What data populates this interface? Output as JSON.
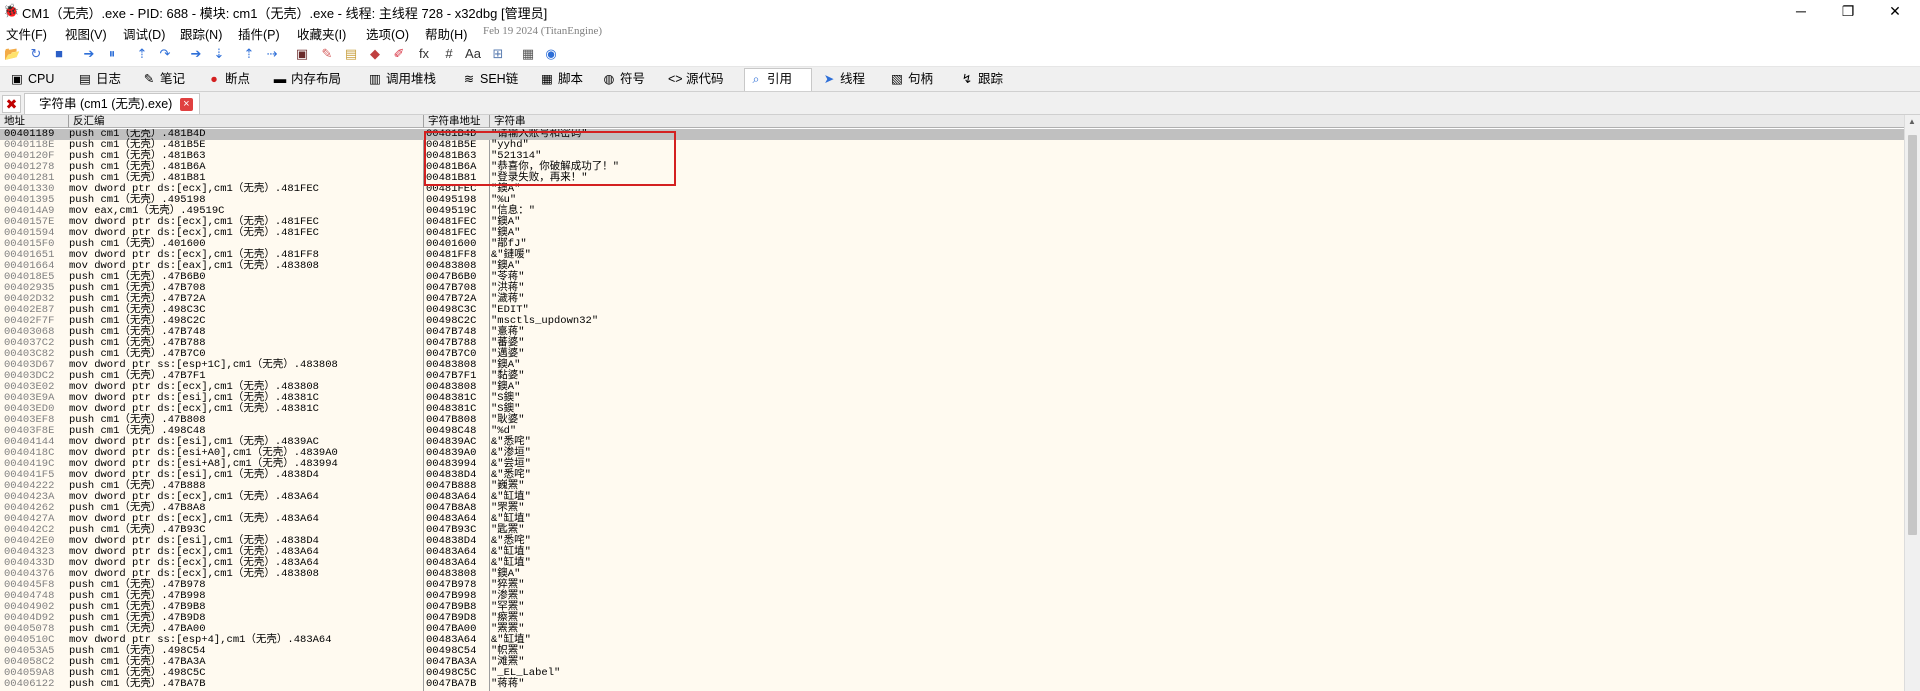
{
  "window": {
    "title": "CM1（无壳）.exe - PID: 688 - 模块: cm1（无壳）.exe - 线程: 主线程 728 - x32dbg [管理员]",
    "minimize": "─",
    "restore": "❐",
    "close": "✕"
  },
  "menu": {
    "items": [
      "文件(F)",
      "视图(V)",
      "调试(D)",
      "跟踪(N)",
      "插件(P)",
      "收藏夹(I)",
      "选项(O)",
      "帮助(H)"
    ],
    "date": "Feb 19 2024 (TitanEngine)"
  },
  "toolbar": {
    "icons": [
      "open-icon",
      "restart-icon",
      "stop-icon",
      "run-icon",
      "pause-icon",
      "step-into-icon",
      "step-over-icon",
      "trace-into-icon",
      "trace-over-icon",
      "execute-till-return-icon",
      "run-to-user-code-icon",
      "scylla-icon",
      "patch-icon",
      "comment-icon",
      "bookmark-icon",
      "label-icon",
      "function-icon",
      "hash-icon",
      "strings-font-icon",
      "calculator-icon",
      "settings-icon",
      "help-icon"
    ],
    "glyphs": [
      "📂",
      "↻",
      "■",
      "➔",
      "⏸",
      "⇡",
      "↷",
      "➔",
      "⇣",
      "⇡",
      "⇢",
      "▣",
      "✎",
      "▤",
      "◆",
      "✐",
      "fx",
      "#",
      "Aa",
      "⊞",
      "▦",
      "◉"
    ],
    "colors": [
      "#d9a441",
      "#3e6fd4",
      "#2b5fc7",
      "#2e6fd8",
      "#2e6fd8",
      "#2e6fd8",
      "#2e6fd8",
      "#2e6fd8",
      "#2e6fd8",
      "#2e6fd8",
      "#2e6fd8",
      "#6b2b2b",
      "#d45a5a",
      "#c8a040",
      "#c04040",
      "#d83040",
      "#333333",
      "#333333",
      "#333333",
      "#5a7cb0",
      "#555555",
      "#2e6fd8"
    ]
  },
  "tabs": [
    {
      "label": "CPU",
      "icon": "cpu-icon",
      "glyph": "▣"
    },
    {
      "label": "日志",
      "icon": "log-icon",
      "glyph": "▤"
    },
    {
      "label": "笔记",
      "icon": "notes-icon",
      "glyph": "✎"
    },
    {
      "label": "断点",
      "icon": "breakpoint-icon",
      "glyph": "●"
    },
    {
      "label": "内存布局",
      "icon": "memory-map-icon",
      "glyph": "▬"
    },
    {
      "label": "调用堆栈",
      "icon": "call-stack-icon",
      "glyph": "▥"
    },
    {
      "label": "SEH链",
      "icon": "seh-icon",
      "glyph": "≋"
    },
    {
      "label": "脚本",
      "icon": "script-icon",
      "glyph": "▦"
    },
    {
      "label": "符号",
      "icon": "symbols-icon",
      "glyph": "◍"
    },
    {
      "label": "源代码",
      "icon": "source-icon",
      "glyph": "<>"
    },
    {
      "label": "引用",
      "icon": "references-icon",
      "glyph": "⌕"
    },
    {
      "label": "线程",
      "icon": "threads-icon",
      "glyph": "➤"
    },
    {
      "label": "句柄",
      "icon": "handles-icon",
      "glyph": "▧"
    },
    {
      "label": "跟踪",
      "icon": "trace-icon",
      "glyph": "↯"
    }
  ],
  "active_tab": "引用",
  "subtab": {
    "label": "字符串 (cm1 (无壳).exe)",
    "close": "×",
    "close_all": "✖"
  },
  "columns": {
    "address": "地址",
    "disassembly": "反汇编",
    "string_address": "字符串地址",
    "string": "字符串"
  },
  "rows": [
    [
      "00401189",
      "push cm1（无壳）.481B4D",
      "00481B4D",
      "\"请输入账号和密码\""
    ],
    [
      "0040118E",
      "push cm1（无壳）.481B5E",
      "00481B5E",
      "\"yyhd\""
    ],
    [
      "0040120F",
      "push cm1（无壳）.481B63",
      "00481B63",
      "\"521314\""
    ],
    [
      "00401278",
      "push cm1（无壳）.481B6A",
      "00481B6A",
      "\"恭喜你，你破解成功了！\""
    ],
    [
      "00401281",
      "push cm1（无壳）.481B81",
      "00481B81",
      "\"登录失败，再来！\""
    ],
    [
      "00401330",
      "mov dword ptr ds:[ecx],cm1（无壳）.481FEC",
      "00481FEC",
      "\"鐭A\""
    ],
    [
      "00401395",
      "push cm1（无壳）.495198",
      "00495198",
      "\"%u\""
    ],
    [
      "004014A9",
      "mov eax,cm1（无壳）.49519C",
      "0049519C",
      "\"信息：\""
    ],
    [
      "0040157E",
      "mov dword ptr ds:[ecx],cm1（无壳）.481FEC",
      "00481FEC",
      "\"鐭A\""
    ],
    [
      "00401594",
      "mov dword ptr ds:[ecx],cm1（无壳）.481FEC",
      "00481FEC",
      "\"鐭A\""
    ],
    [
      "004015F0",
      "push cm1（无壳）.401600",
      "00401600",
      "\"鄁fJ\""
    ],
    [
      "00401651",
      "mov dword ptr ds:[ecx],cm1（无壳）.481FF8",
      "00481FF8",
      "&\"鏈喛\""
    ],
    [
      "00401664",
      "mov dword ptr ds:[eax],cm1（无壳）.483808",
      "00483808",
      "\"鐭A\""
    ],
    [
      "004018E5",
      "push cm1（无壳）.47B6B0",
      "0047B6B0",
      "\"苓蒋\""
    ],
    [
      "00402935",
      "push cm1（无壳）.47B708",
      "0047B708",
      "\"洪蒋\""
    ],
    [
      "00402D32",
      "push cm1（无壳）.47B72A",
      "0047B72A",
      "\"濊蒋\""
    ],
    [
      "00402E87",
      "push cm1（无壳）.498C3C",
      "00498C3C",
      "\"EDIT\""
    ],
    [
      "00402F7F",
      "push cm1（无壳）.498C2C",
      "00498C2C",
      "\"msctls_updown32\""
    ],
    [
      "00403068",
      "push cm1（无壳）.47B748",
      "0047B748",
      "\"憙蒋\""
    ],
    [
      "004037C2",
      "push cm1（无壳）.47B788",
      "0047B788",
      "\"蕃婆\""
    ],
    [
      "00403C82",
      "push cm1（无壳）.47B7C0",
      "0047B7C0",
      "\"邁婆\""
    ],
    [
      "00403D67",
      "mov dword ptr ss:[esp+1C],cm1（无壳）.483808",
      "00483808",
      "\"鐭A\""
    ],
    [
      "00403DC2",
      "push cm1（无壳）.47B7F1",
      "0047B7F1",
      "\"黏婆\""
    ],
    [
      "00403E02",
      "mov dword ptr ds:[ecx],cm1（无壳）.483808",
      "00483808",
      "\"鐭A\""
    ],
    [
      "00403E9A",
      "mov dword ptr ds:[esi],cm1（无壳）.48381C",
      "0048381C",
      "\"S鐭\""
    ],
    [
      "00403ED0",
      "mov dword ptr ds:[ecx],cm1（无壳）.48381C",
      "0048381C",
      "\"S鐭\""
    ],
    [
      "00403EF8",
      "push cm1（无壳）.47B808",
      "0047B808",
      "\"耿婆\""
    ],
    [
      "00403F8E",
      "push cm1（无壳）.498C48",
      "00498C48",
      "\"%d\""
    ],
    [
      "00404144",
      "mov dword ptr ds:[esi],cm1（无壳）.4839AC",
      "004839AC",
      "&\"悉咤\""
    ],
    [
      "0040418C",
      "mov dword ptr ds:[esi+A0],cm1（无壳）.4839A0",
      "004839A0",
      "&\"渗垣\""
    ],
    [
      "0040419C",
      "mov dword ptr ds:[esi+A8],cm1（无壳）.483994",
      "00483994",
      "&\"尝垣\""
    ],
    [
      "004041F5",
      "mov dword ptr ds:[esi],cm1（无壳）.4838D4",
      "004838D4",
      "&\"悉咤\""
    ],
    [
      "00404222",
      "push cm1（无壳）.47B888",
      "0047B888",
      "\"巍罴\""
    ],
    [
      "0040423A",
      "mov dword ptr ds:[ecx],cm1（无壳）.483A64",
      "00483A64",
      "&\"缸埴\""
    ],
    [
      "00404262",
      "push cm1（无壳）.47B8A8",
      "0047B8A8",
      "\"罘罴\""
    ],
    [
      "0040427A",
      "mov dword ptr ds:[ecx],cm1（无壳）.483A64",
      "00483A64",
      "&\"缸埴\""
    ],
    [
      "004042C2",
      "push cm1（无壳）.47B93C",
      "0047B93C",
      "\"匙罴\""
    ],
    [
      "004042E0",
      "mov dword ptr ds:[esi],cm1（无壳）.4838D4",
      "004838D4",
      "&\"悉咤\""
    ],
    [
      "00404323",
      "mov dword ptr ds:[ecx],cm1（无壳）.483A64",
      "00483A64",
      "&\"缸埴\""
    ],
    [
      "0040433D",
      "mov dword ptr ds:[ecx],cm1（无壳）.483A64",
      "00483A64",
      "&\"缸埴\""
    ],
    [
      "00404376",
      "mov dword ptr ds:[ecx],cm1（无壳）.483808",
      "00483808",
      "\"鐭A\""
    ],
    [
      "004045F8",
      "push cm1（无壳）.47B978",
      "0047B978",
      "\"猝罴\""
    ],
    [
      "00404748",
      "push cm1（无壳）.47B998",
      "0047B998",
      "\"渗罴\""
    ],
    [
      "00404902",
      "push cm1（无壳）.47B9B8",
      "0047B9B8",
      "\"罕罴\""
    ],
    [
      "00404D92",
      "push cm1（无壳）.47B9D8",
      "0047B9D8",
      "\"瘵罴\""
    ],
    [
      "00405078",
      "push cm1（无壳）.47BA00",
      "0047BA00",
      "\"罴罴\""
    ],
    [
      "0040510C",
      "mov dword ptr ss:[esp+4],cm1（无壳）.483A64",
      "00483A64",
      "&\"缸埴\""
    ],
    [
      "004053A5",
      "push cm1（无壳）.498C54",
      "00498C54",
      "\"帜罴\""
    ],
    [
      "004058C2",
      "push cm1（无壳）.47BA3A",
      "0047BA3A",
      "\"滩罴\""
    ],
    [
      "004059A8",
      "push cm1（无壳）.498C5C",
      "00498C5C",
      "\"_EL_Label\""
    ],
    [
      "00406122",
      "push cm1（无壳）.47BA7B",
      "0047BA7B",
      "\"蒋蒋\""
    ]
  ]
}
